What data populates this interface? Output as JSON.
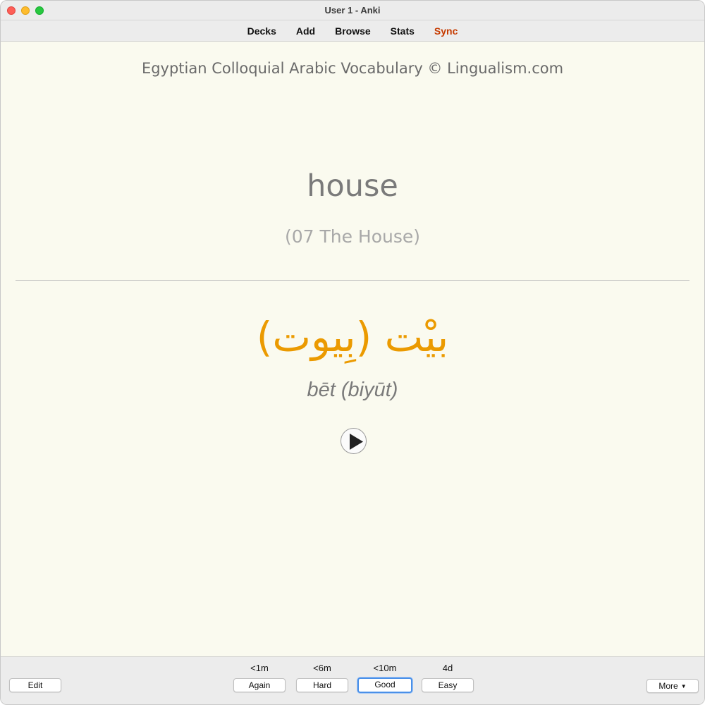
{
  "window": {
    "title": "User 1 - Anki"
  },
  "toolbar": {
    "items": [
      "Decks",
      "Add",
      "Browse",
      "Stats",
      "Sync"
    ],
    "sync_color": "#c63b00"
  },
  "card": {
    "deck_title": "Egyptian Colloquial Arabic Vocabulary © Lingualism.com",
    "front_word": "house",
    "front_tag": "(07 The House)",
    "arabic": "بيْت (بِيوت)",
    "arabic_color": "#eb9a00",
    "transliteration": "bēt (biyūt)",
    "audio_icon": "play-icon"
  },
  "bottom": {
    "edit_label": "Edit",
    "more_label": "More",
    "answers": [
      {
        "interval": "<1m",
        "label": "Again"
      },
      {
        "interval": "<6m",
        "label": "Hard"
      },
      {
        "interval": "<10m",
        "label": "Good"
      },
      {
        "interval": "4d",
        "label": "Easy"
      }
    ],
    "default_answer": "Good"
  }
}
